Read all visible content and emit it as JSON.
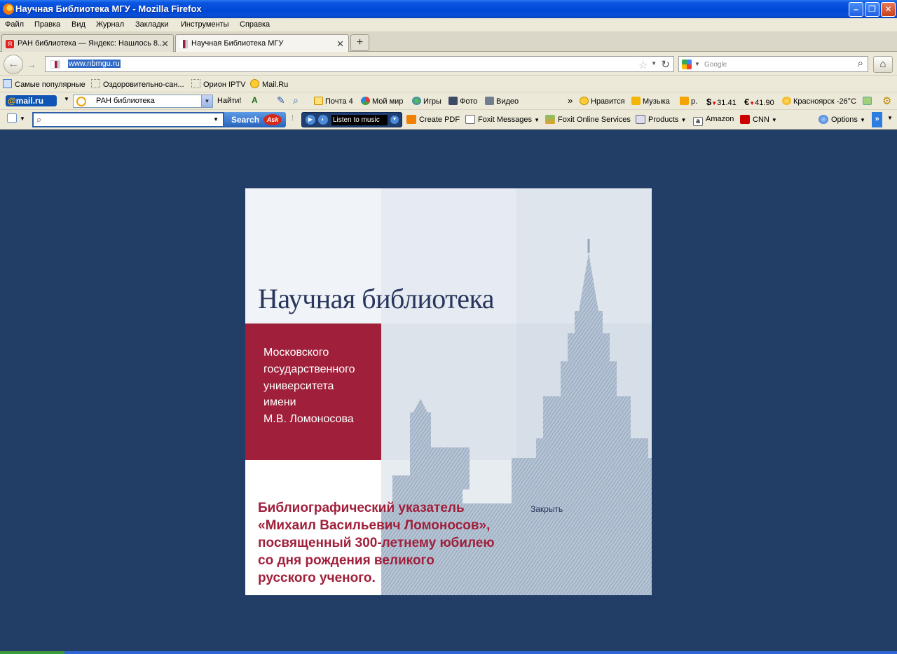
{
  "window": {
    "title": "Научная Библиотека МГУ - Mozilla Firefox",
    "min": "–",
    "max": "❐",
    "close": "✕"
  },
  "menu": [
    "Файл",
    "Правка",
    "Вид",
    "Журнал",
    "Закладки",
    "Инструменты",
    "Справка"
  ],
  "tabs": [
    {
      "label": "РАН библиотека — Яндекс: Нашлось 8...",
      "close": "✕"
    },
    {
      "label": "Научная Библиотека МГУ",
      "close": "✕"
    }
  ],
  "newtab": "+",
  "nav": {
    "back": "←",
    "forward": "→",
    "url": "www.nbmgu.ru",
    "star": "☆",
    "dropdown": "▼",
    "reload": "↻",
    "search_placeholder": "Google",
    "search_icon": "⌕",
    "home": "⌂"
  },
  "bookmarks": [
    "Самые популярные",
    "Оздоровительно-сан...",
    "Орион IPTV",
    "Mail.Ru"
  ],
  "mailbar": {
    "logo_at": "@",
    "logo_rest": "mail.ru",
    "search_value": "РАН библиотека",
    "find": "Найти!",
    "mail": "Почта 4",
    "myworld": "Мой мир",
    "games": "Игры",
    "photo": "Фото",
    "video": "Видео",
    "more": "»",
    "likes": "Нравится",
    "music": "Музыка",
    "rub": "р.",
    "usd": "31.41",
    "eur": "41.90",
    "weather": "Красноярск -26°C"
  },
  "askbar": {
    "search_btn": "Search",
    "ask": "Ask",
    "music": "Listen to music",
    "pdf": "Create PDF",
    "foxit_msg": "Foxit Messages",
    "foxit_online": "Foxit Online Services",
    "products": "Products",
    "amazon": "Amazon",
    "cnn": "CNN",
    "options": "Options",
    "more": "»"
  },
  "splash": {
    "title": "Научная библиотека",
    "subtitle_lines": [
      "Московского",
      "государственного",
      "университета",
      "имени",
      "М.В. Ломоносова"
    ],
    "bib_lines": [
      "Библиографический указатель",
      "«Михаил Васильевич Ломоносов»,",
      "посвященный 300-летнему юбилею",
      "со дня рождения великого",
      "русского ученого."
    ],
    "close": "Закрыть"
  },
  "colors": {
    "page_bg": "#233e66",
    "title_blue": "#28365e",
    "accent_red": "#a01f3a"
  }
}
